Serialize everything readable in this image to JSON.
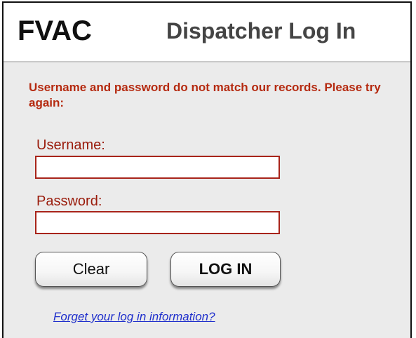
{
  "header": {
    "logo": "FVAC",
    "title": "Dispatcher Log In"
  },
  "error": {
    "message": "Username and password do not match our records. Please try again:"
  },
  "form": {
    "username_label": "Username:",
    "username_value": "",
    "password_label": "Password:",
    "password_value": "",
    "clear_label": "Clear",
    "login_label": "LOG IN",
    "forgot_label": "Forget your log in information?"
  },
  "colors": {
    "error_text": "#b52a10",
    "label_text": "#9a1c0c",
    "input_border": "#a8241a",
    "link": "#1f2fcc",
    "panel_bg": "#ebebeb"
  }
}
